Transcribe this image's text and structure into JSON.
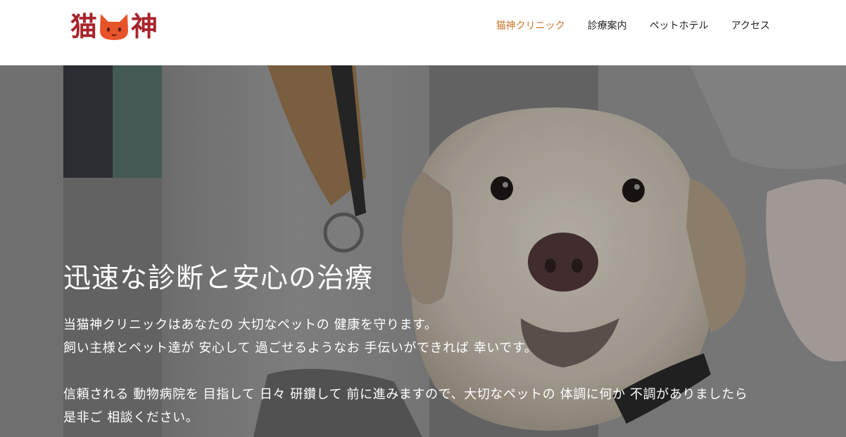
{
  "header": {
    "logo": {
      "char_left": "猫",
      "char_right": "神",
      "icon": "cat-face-icon"
    },
    "nav": [
      {
        "label": "猫神クリニック",
        "active": true
      },
      {
        "label": "診療案内",
        "active": false
      },
      {
        "label": "ペットホテル",
        "active": false
      },
      {
        "label": "アクセス",
        "active": false
      }
    ]
  },
  "hero": {
    "title": "迅速な診断と安心の治療",
    "paragraphs": [
      "当猫神クリニックはあなたの 大切なペットの 健康を守ります。",
      "飼い主様とペット達が 安心して 過ごせるようなお 手伝いができれば 幸いです。",
      "信頼される 動物病院を 目指して 日々 研鑽して 前に進みますので、大切なペットの 体調に何か 不調がありましたら",
      "是非ご 相談ください。"
    ]
  },
  "colors": {
    "accent": "#c8742a",
    "brand": "#a8232b",
    "cat": "#e8542a"
  }
}
